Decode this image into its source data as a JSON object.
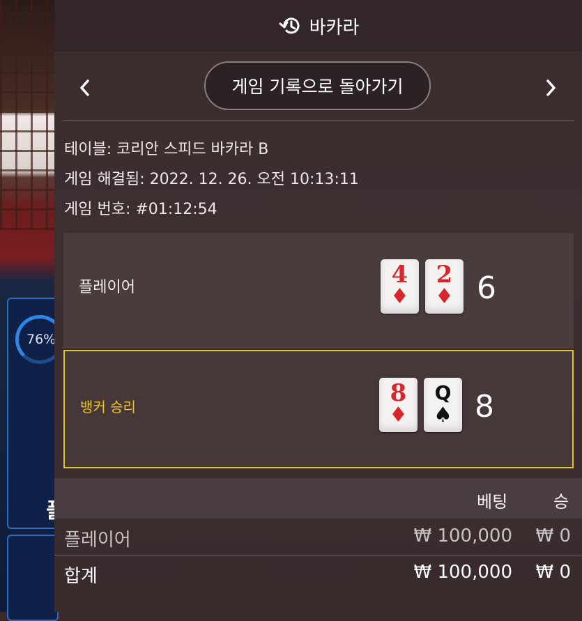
{
  "background": {
    "progress_text": "76%",
    "panel_glyph": "플"
  },
  "header": {
    "title": "바카라",
    "icon": "history-icon"
  },
  "nav": {
    "back_label": "게임 기록으로 돌아가기",
    "prev_icon": "chevron-left-icon",
    "next_icon": "chevron-right-icon"
  },
  "info": {
    "table": "테이블: 코리안 스피드 바카라 B",
    "resolved": "게임 해결됨: 2022. 12. 26. 오전 10:13:11",
    "game_number": "게임 번호: #01:12:54"
  },
  "hands": {
    "player": {
      "label": "플레이어",
      "cards": [
        {
          "rank": "4",
          "suit": "♦",
          "color": "#d8262b"
        },
        {
          "rank": "2",
          "suit": "♦",
          "color": "#d8262b"
        }
      ],
      "score": "6"
    },
    "banker": {
      "label": "뱅커 승리",
      "cards": [
        {
          "rank": "8",
          "suit": "♦",
          "color": "#d8262b"
        },
        {
          "rank": "Q",
          "suit": "♠",
          "color": "#111111"
        }
      ],
      "score": "8",
      "highlight_color": "#e2c22c"
    }
  },
  "bets_table": {
    "headers": {
      "bet": "베팅",
      "win": "승"
    },
    "rows": [
      {
        "name": "플레이어",
        "bet": "₩ 100,000",
        "win": "₩ 0"
      },
      {
        "name": "합계",
        "bet": "₩ 100,000",
        "win": "₩ 0"
      }
    ]
  }
}
